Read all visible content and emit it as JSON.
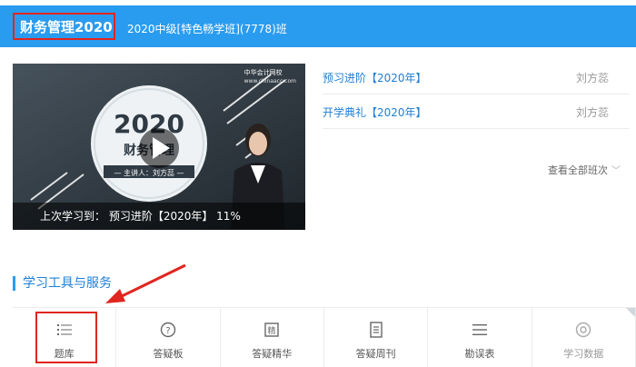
{
  "header": {
    "course_title": "财务管理2020",
    "class_name": "2020中级[特色畅学班](7778)班"
  },
  "video": {
    "logo_name": "中华会计网校",
    "logo_url": "www.chinaacc.com",
    "cover_year": "2020",
    "cover_subject": "财务管理",
    "cover_presenter": "— 主讲人：刘方蕊 —",
    "last_study_text": "上次学习到：  预习进阶【2020年】 11%",
    "progress_percent": 11
  },
  "lessons": [
    {
      "title": "预习进阶【2020年】",
      "teacher": "刘方蕊"
    },
    {
      "title": "开学典礼【2020年】",
      "teacher": "刘方蕊"
    }
  ],
  "view_all": "查看全部班次",
  "section_title": "学习工具与服务",
  "tools": [
    {
      "label": "题库",
      "icon": "list-icon"
    },
    {
      "label": "答疑板",
      "icon": "question-icon"
    },
    {
      "label": "答疑精华",
      "icon": "book-icon"
    },
    {
      "label": "答疑周刊",
      "icon": "document-icon"
    },
    {
      "label": "勘误表",
      "icon": "menu-icon"
    },
    {
      "label": "学习数据",
      "icon": "disc-icon"
    }
  ],
  "colors": {
    "header_blue": "#2a9cf0",
    "link_blue": "#1f7fd6",
    "highlight_red": "#e0261f"
  }
}
